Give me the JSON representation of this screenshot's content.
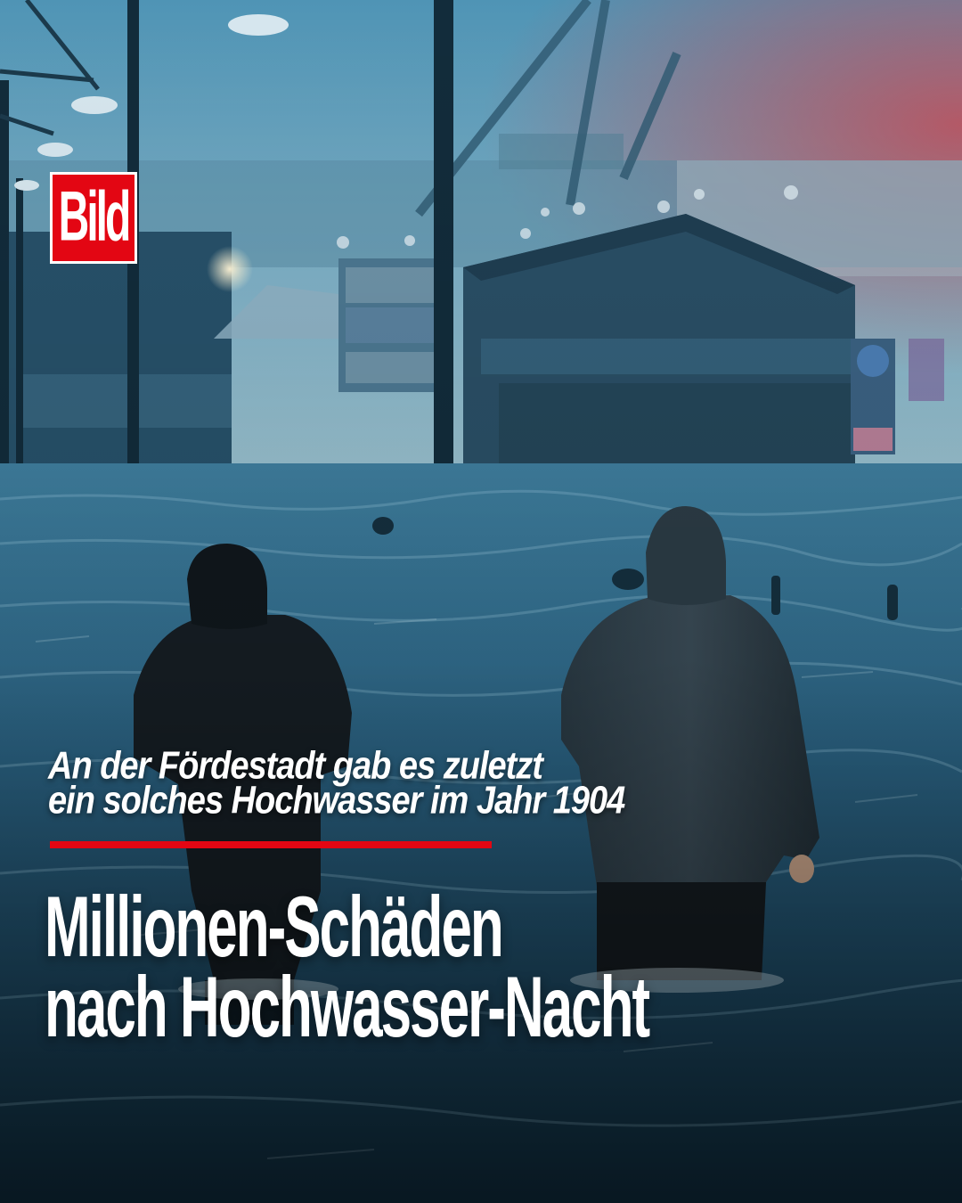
{
  "brand": {
    "logo_text": "Bild",
    "color": "#e30613"
  },
  "kicker": {
    "line1": "An der Fördestadt gab es zuletzt",
    "line2": "ein solches Hochwasser im Jahr 1904"
  },
  "headline": {
    "line1": "Millionen-Schäden",
    "line2": "nach Hochwasser-Nacht"
  },
  "photo": {
    "subject": "flooded-harbor-street-two-people-wading"
  }
}
